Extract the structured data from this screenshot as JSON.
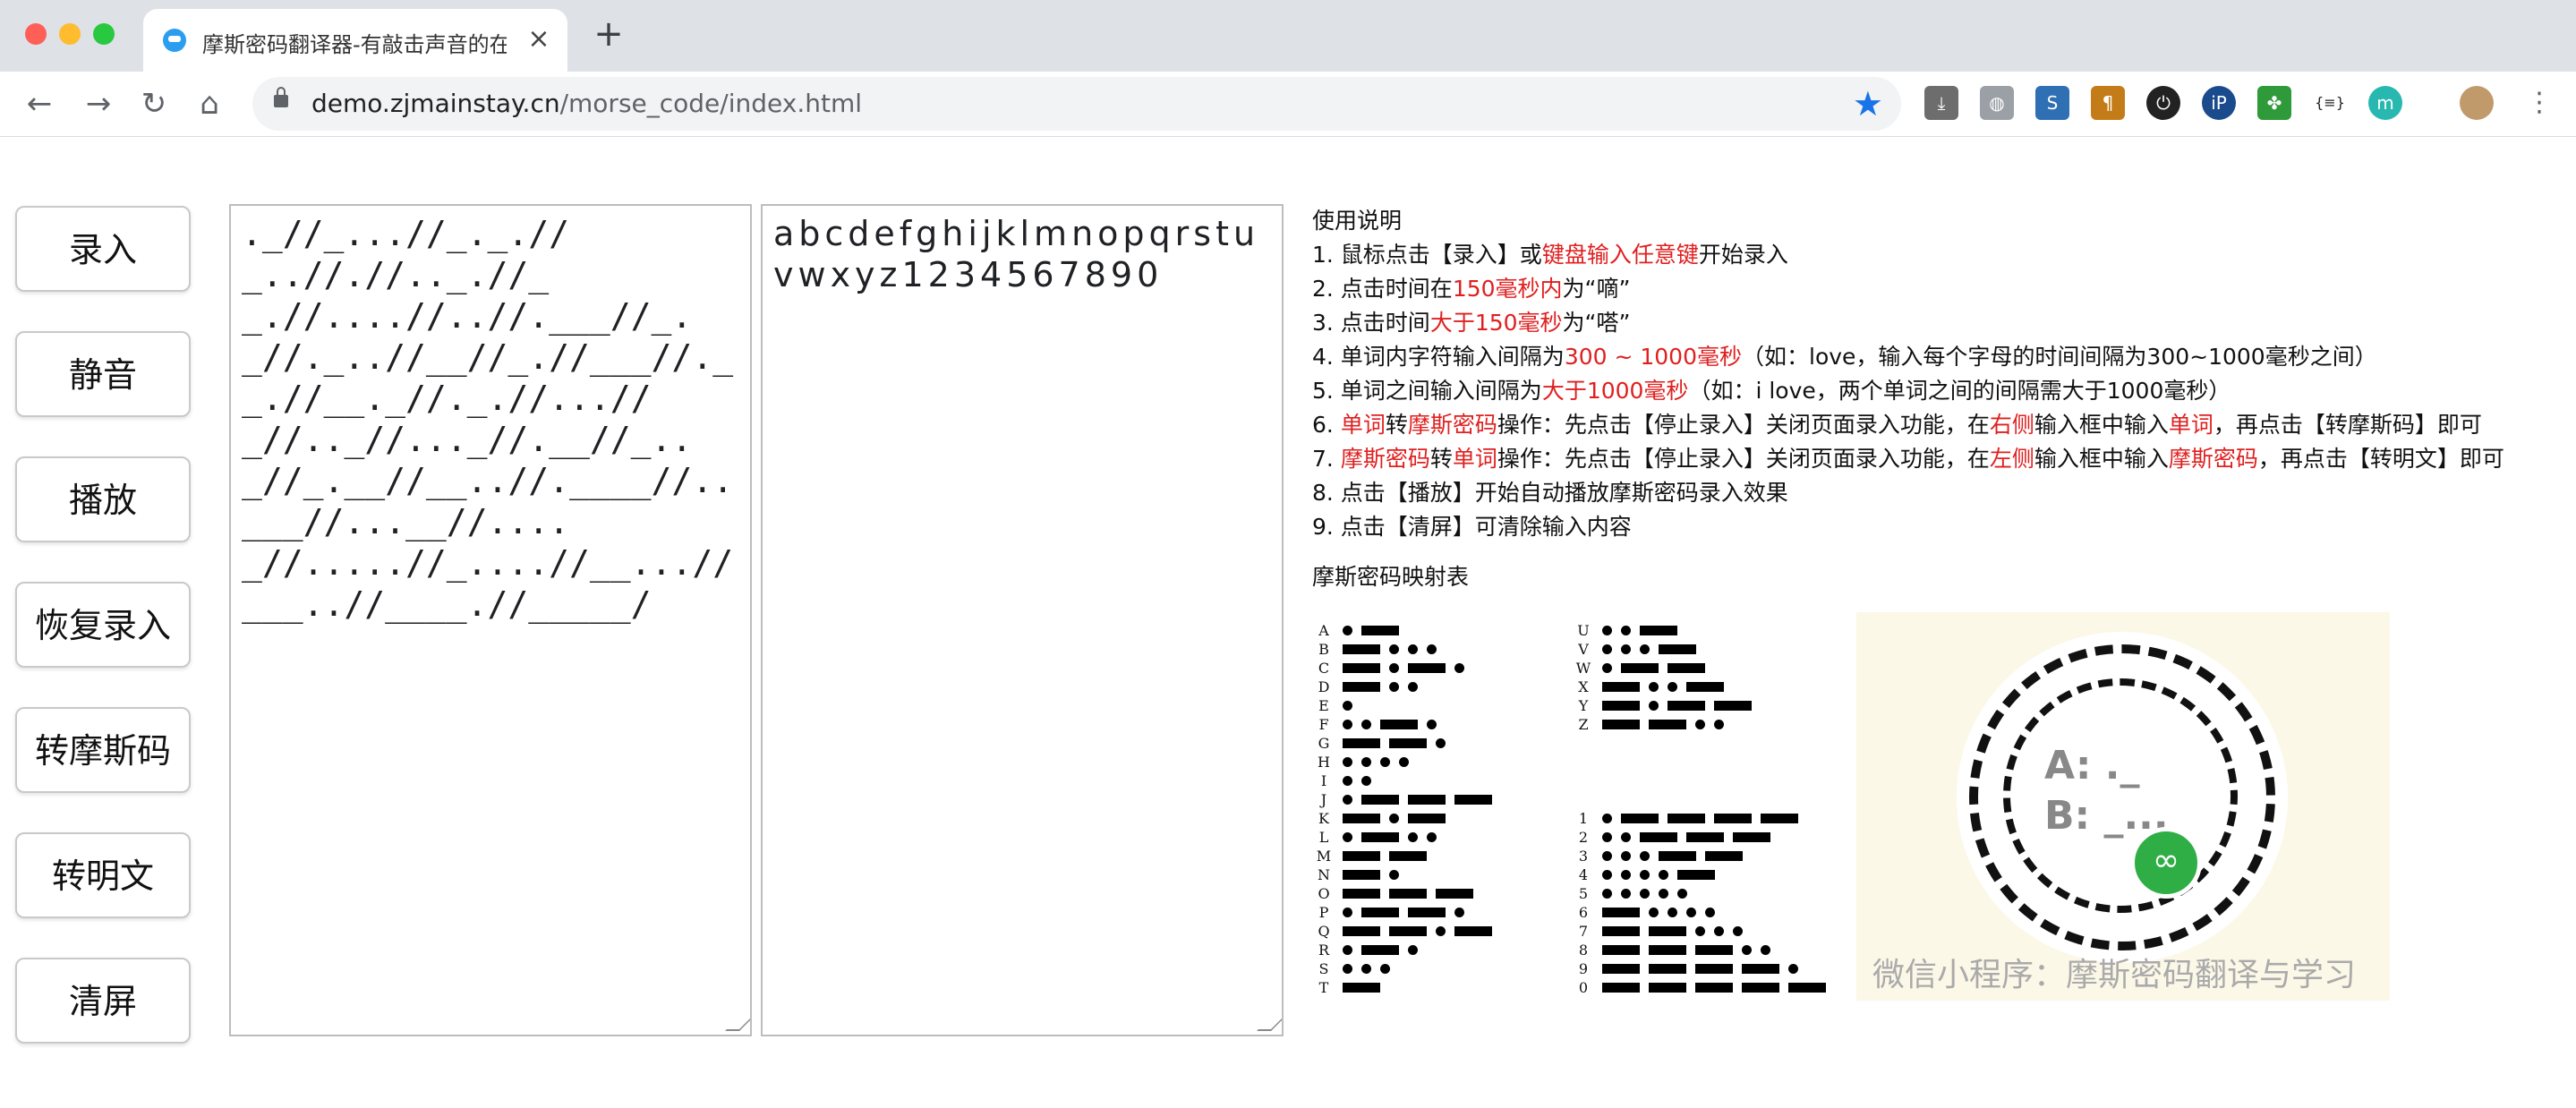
{
  "browser": {
    "tab_title": "摩斯密码翻译器-有敲击声音的在线摩斯",
    "tab_close": "×",
    "new_tab": "+",
    "url_host": "demo.zjmainstay.cn",
    "url_path": "/morse_code/index.html",
    "nav": {
      "back": "←",
      "forward": "→",
      "reload": "↻",
      "home": "⌂"
    },
    "bookmark_icon": "★",
    "extensions": [
      "download-icon",
      "globe-icon",
      "s-icon",
      "pilcrow-icon",
      "power-icon",
      "ip-icon",
      "clover-icon",
      "json-icon",
      "m-icon",
      "avatar"
    ],
    "extension_labels": [
      "⤓",
      "◍",
      "S",
      "¶",
      "⏻",
      "iP",
      "✤",
      "{≡}",
      "m",
      ""
    ]
  },
  "buttons": [
    "录入",
    "静音",
    "播放",
    "恢复录入",
    "转摩斯码",
    "转明文",
    "清屏"
  ],
  "morse_input": "._//_...//_._.//_..//.//.._.//__.//....//..//.___//_._//._..//__//_.//___//.__.//__._//._.//...//_//.._//..._//.__//_.._//_.__//__..//.____//..___//...__//...._//.....//_....//__...//___..//____.//_____/",
  "text_output": "abcdefghijklmnopqrstuvwxyz1234567890",
  "instructions": {
    "title": "使用说明",
    "lines": [
      [
        {
          "t": "1. 鼠标点击【录入】或"
        },
        {
          "t": "键盘输入任意键",
          "red": true
        },
        {
          "t": "开始录入"
        }
      ],
      [
        {
          "t": "2. 点击时间在"
        },
        {
          "t": "150毫秒内",
          "red": true
        },
        {
          "t": "为“嘀”"
        }
      ],
      [
        {
          "t": "3. 点击时间"
        },
        {
          "t": "大于150毫秒",
          "red": true
        },
        {
          "t": "为“嗒”"
        }
      ],
      [
        {
          "t": "4. 单词内字符输入间隔为"
        },
        {
          "t": "300 ~ 1000毫秒",
          "red": true
        },
        {
          "t": "（如：love，输入每个字母的时间间隔为300~1000毫秒之间）"
        }
      ],
      [
        {
          "t": "5. 单词之间输入间隔为"
        },
        {
          "t": "大于1000毫秒",
          "red": true
        },
        {
          "t": "（如：i love，两个单词之间的间隔需大于1000毫秒）"
        }
      ],
      [
        {
          "t": "6. "
        },
        {
          "t": "单词",
          "red": true
        },
        {
          "t": "转"
        },
        {
          "t": "摩斯密码",
          "red": true
        },
        {
          "t": "操作：先点击【停止录入】关闭页面录入功能，在"
        },
        {
          "t": "右侧",
          "red": true
        },
        {
          "t": "输入框中输入"
        },
        {
          "t": "单词",
          "red": true
        },
        {
          "t": "，再点击【转摩斯码】即可"
        }
      ],
      [
        {
          "t": "7. "
        },
        {
          "t": "摩斯密码",
          "red": true
        },
        {
          "t": "转"
        },
        {
          "t": "单词",
          "red": true
        },
        {
          "t": "操作：先点击【停止录入】关闭页面录入功能，在"
        },
        {
          "t": "左侧",
          "red": true
        },
        {
          "t": "输入框中输入"
        },
        {
          "t": "摩斯密码",
          "red": true
        },
        {
          "t": "，再点击【转明文】即可"
        }
      ],
      [
        {
          "t": "8. 点击【播放】开始自动播放摩斯密码录入效果"
        }
      ],
      [
        {
          "t": "9. 点击【清屏】可清除输入内容"
        }
      ]
    ]
  },
  "map_title": "摩斯密码映射表",
  "morse_map_left": [
    [
      "A",
      ".-"
    ],
    [
      "B",
      "-..."
    ],
    [
      "C",
      "-.-."
    ],
    [
      "D",
      "-.."
    ],
    [
      "E",
      "."
    ],
    [
      "F",
      "..-."
    ],
    [
      "G",
      "--."
    ],
    [
      "H",
      "...."
    ],
    [
      "I",
      ".."
    ],
    [
      "J",
      ".---"
    ],
    [
      "K",
      "-.-"
    ],
    [
      "L",
      ".-.."
    ],
    [
      "M",
      "--"
    ],
    [
      "N",
      "-."
    ],
    [
      "O",
      "---"
    ],
    [
      "P",
      ".--."
    ],
    [
      "Q",
      "--.-"
    ],
    [
      "R",
      ".-."
    ],
    [
      "S",
      "..."
    ],
    [
      "T",
      "-"
    ]
  ],
  "morse_map_right_top": [
    [
      "U",
      "..-"
    ],
    [
      "V",
      "...-"
    ],
    [
      "W",
      ".--"
    ],
    [
      "X",
      "-..-"
    ],
    [
      "Y",
      "-.--"
    ],
    [
      "Z",
      "--.."
    ]
  ],
  "morse_map_right_bottom": [
    [
      "1",
      ".----"
    ],
    [
      "2",
      "..---"
    ],
    [
      "3",
      "...--"
    ],
    [
      "4",
      "....-"
    ],
    [
      "5",
      "....."
    ],
    [
      "6",
      "-...."
    ],
    [
      "7",
      "--..."
    ],
    [
      "8",
      "---.."
    ],
    [
      "9",
      "----."
    ],
    [
      "0",
      "-----"
    ]
  ],
  "qr": {
    "line_a": "A: ._",
    "line_b": "B: _...",
    "caption": "微信小程序：摩斯密码翻译与学习",
    "badge": "∞"
  }
}
